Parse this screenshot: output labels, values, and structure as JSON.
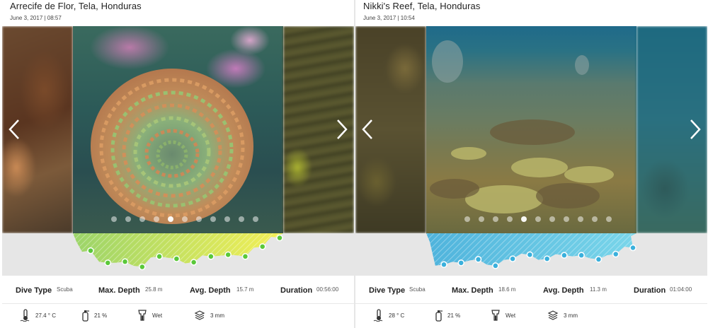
{
  "cards": [
    {
      "title": "Arrecife de Flor, Tela, Honduras",
      "datetime": "June 3, 2017 | 08:57",
      "gallery": {
        "image": "scroll-coral-closeup",
        "photo_count": 11,
        "active_index": 4,
        "colors": {
          "main": "#5c8a6e",
          "left": "#5a3a28",
          "right": "#4a4a28"
        }
      },
      "profile": {
        "colors": {
          "from": "#9bd46a",
          "to": "#f4f056",
          "marker": "#5ac83a"
        },
        "depth_series": [
          3.0,
          5.1,
          4.9,
          5.8,
          4.0,
          4.4,
          5.0,
          4.0,
          3.7,
          4.0,
          2.3,
          0.8
        ]
      },
      "stats": {
        "dive_type_label": "Dive Type",
        "dive_type_value": "Scuba",
        "max_depth_label": "Max. Depth",
        "max_depth_value": "25.8 m",
        "avg_depth_label": "Avg. Depth",
        "avg_depth_value": "15.7 m",
        "duration_label": "Duration",
        "duration_value": "00:56:00"
      },
      "extras": {
        "temperature": "27.4 ° C",
        "air": "21 %",
        "suit": "Wet",
        "thickness": "3 mm"
      }
    },
    {
      "title": "Nikki's Reef, Tela, Honduras",
      "datetime": "June 3, 2017 | 10:54",
      "gallery": {
        "image": "reef-landscape",
        "photo_count": 11,
        "active_index": 4,
        "colors": {
          "main": "#4f7a72",
          "left": "#5a5030",
          "right": "#2e6a7a"
        }
      },
      "profile": {
        "colors": {
          "from": "#4fb3dc",
          "to": "#7ad6ea",
          "marker": "#3ab0dc"
        },
        "depth_series": [
          5.4,
          5.1,
          4.5,
          5.6,
          4.4,
          3.7,
          4.4,
          3.8,
          3.8,
          4.5,
          3.6,
          2.5
        ]
      },
      "stats": {
        "dive_type_label": "Dive Type",
        "dive_type_value": "Scuba",
        "max_depth_label": "Max. Depth",
        "max_depth_value": "18.6 m",
        "avg_depth_label": "Avg. Depth",
        "avg_depth_value": "11.3 m",
        "duration_label": "Duration",
        "duration_value": "01:04:00"
      },
      "extras": {
        "temperature": "28 ° C",
        "air": "21 %",
        "suit": "Wet",
        "thickness": "3 mm"
      }
    }
  ],
  "icons": {
    "prev": "chevron-left-icon",
    "next": "chevron-right-icon",
    "temperature": "thermometer-icon",
    "air": "tank-icon",
    "suit": "wetsuit-icon",
    "thickness": "layers-icon"
  }
}
